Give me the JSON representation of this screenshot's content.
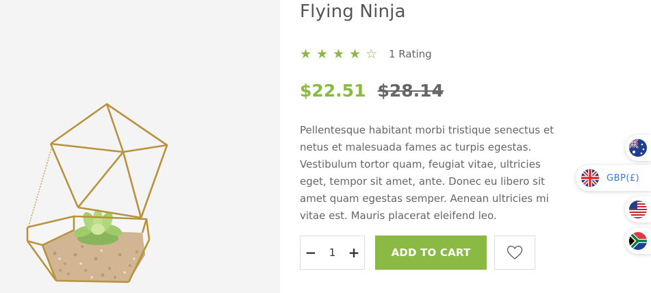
{
  "product": {
    "title": "Flying Ninja",
    "rating": {
      "stars_filled": 4,
      "stars_total": 5,
      "filled_star": "★",
      "empty_star": "☆",
      "count_text": "1 Rating"
    },
    "price": {
      "sale": "$22.51",
      "regular": "$28.14"
    },
    "description": "Pellentesque habitant morbi tristique senectus et netus et malesuada fames ac turpis egestas. Vestibulum tortor quam, feugiat vitae, ultricies eget, tempor sit amet, ante. Donec eu libero sit amet quam egestas semper. Aenean ultricies mi vitae est. Mauris placerat eleifend leo.",
    "image_icon": "succulent-terrarium-image"
  },
  "purchase": {
    "decrement_symbol": "−",
    "quantity": "1",
    "increment_symbol": "+",
    "add_to_cart_label": "ADD TO CART",
    "wishlist_icon": "heart-icon"
  },
  "currency_switcher": {
    "active": {
      "flag": "uk-flag-icon",
      "label": "GBP(£)"
    },
    "options": [
      "au-flag-icon",
      "us-flag-icon",
      "za-flag-icon"
    ]
  },
  "colors": {
    "accent": "#8bba44",
    "text": "#666666",
    "title": "#555555",
    "currency_link": "#3a7bd5",
    "image_background": "#f4f4f4"
  }
}
